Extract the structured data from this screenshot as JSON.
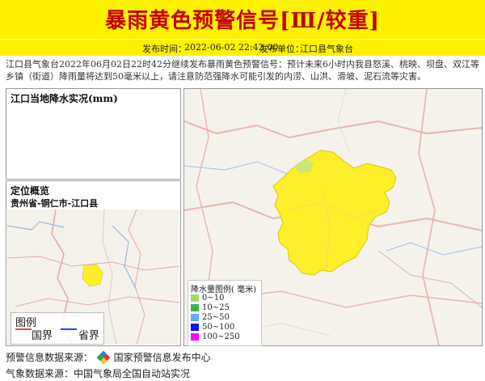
{
  "header": {
    "title": "暴雨黄色预警信号[Ⅲ/较重]",
    "publish_time_label": "发布时间：",
    "publish_time": "2022-06-02 22:42:00",
    "publisher_label": "发布单位：",
    "publisher": "江口县气象台"
  },
  "description": "江口县气象台2022年06月02日22时42分继续发布暴雨黄色预警信号：预计未来6小时内我县怒溪、桃映、坝盘、双江等乡镇（街道）降雨量将达到50毫米以上，请注意防范强降水可能引发的内涝、山洪、滑坡、泥石流等灾害。",
  "rain_panel": {
    "title": "江口当地降水实况(mm)"
  },
  "location_panel": {
    "title": "定位概览",
    "subtitle": "贵州省-铜仁市-江口县",
    "legend_title": "图例",
    "legend_items": [
      {
        "label": "国界",
        "color": "#d9534f"
      },
      {
        "label": "省界",
        "color": "#1d4fd6"
      }
    ]
  },
  "map_legend": {
    "title": "降水量图例( 毫米)",
    "items": [
      {
        "label": "0~10",
        "color": "#a6d96a"
      },
      {
        "label": "10~25",
        "color": "#3cb44b"
      },
      {
        "label": "25~50",
        "color": "#62a8ff"
      },
      {
        "label": "50~100",
        "color": "#0015ff"
      },
      {
        "label": "100~250",
        "color": "#ff00ff"
      }
    ]
  },
  "footer": {
    "source_label": "预警信息数据来源：",
    "source_value": "国家预警信息发布中心",
    "weather_label": "气象数据来源：",
    "weather_value": "中国气象局全国自动站实况"
  },
  "colors": {
    "banner": "#fff200",
    "title": "#c40000",
    "warning_area": "#ffef2a"
  }
}
